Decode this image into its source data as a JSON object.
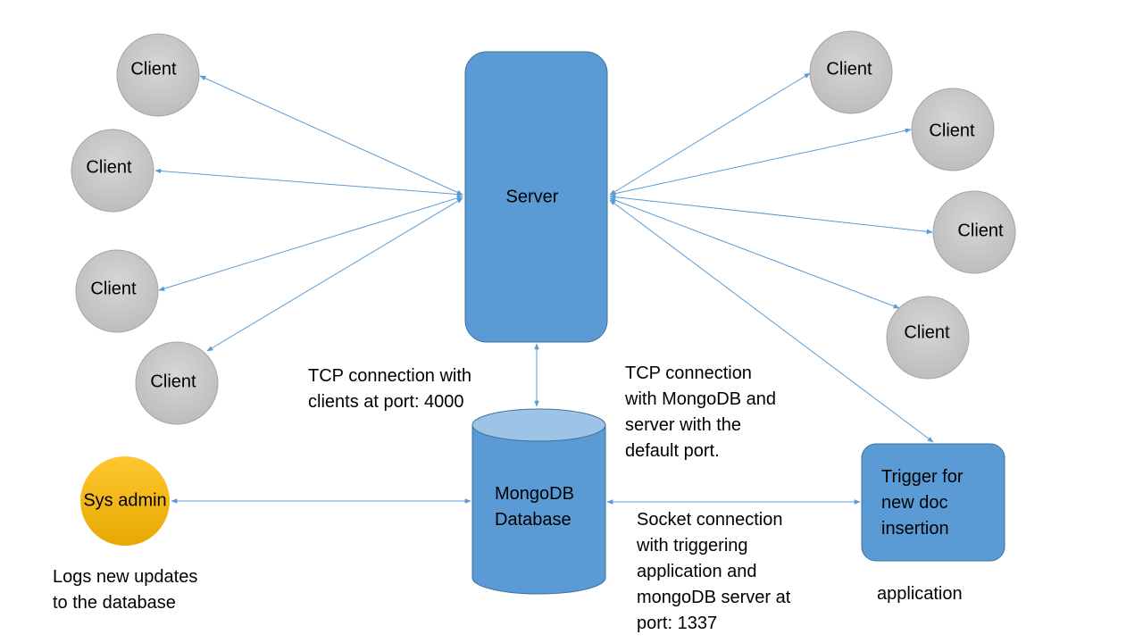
{
  "colors": {
    "node_blue": "#5b9bd5",
    "cylinder_top": "#9dc3e6",
    "client_gray": "#c8c8c8",
    "sysadmin_yellow": "#ffc000",
    "arrow": "#5b9bd5"
  },
  "nodes": {
    "server": "Server",
    "database": [
      "MongoDB",
      "Database"
    ],
    "trigger": [
      "Trigger for",
      "new doc",
      "insertion"
    ],
    "sysadmin": "Sys admin",
    "clients_left": [
      "Client",
      "Client",
      "Client",
      "Client"
    ],
    "clients_right": [
      "Client",
      "Client",
      "Client",
      "Client"
    ]
  },
  "labels": {
    "tcp_clients": [
      "TCP connection with",
      "clients at port: 4000"
    ],
    "tcp_mongo": [
      "TCP connection",
      "with MongoDB and",
      "server with the",
      "default port."
    ],
    "socket": [
      "Socket connection",
      "with triggering",
      "application and",
      "mongoDB server at",
      "port: 1337"
    ],
    "sysadmin_note": [
      "Logs new updates",
      "to the database"
    ],
    "application": "application"
  }
}
